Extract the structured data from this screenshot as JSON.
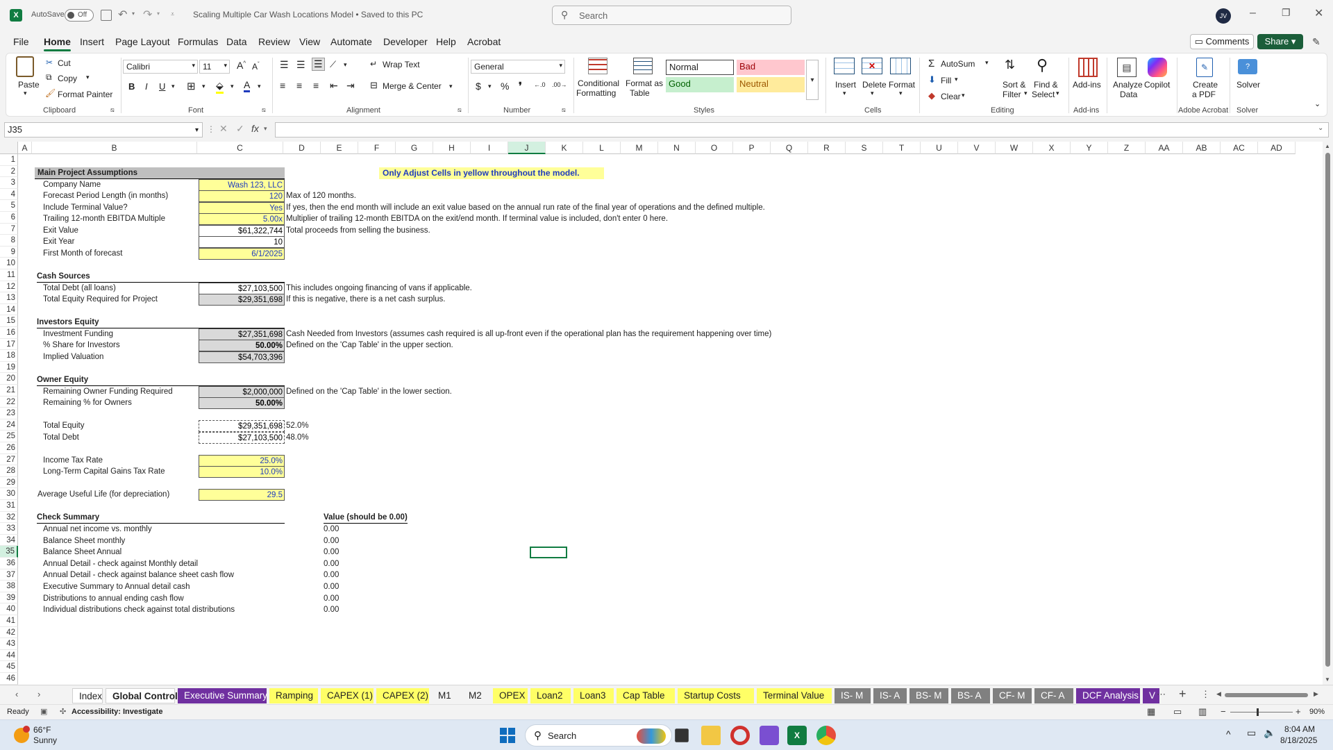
{
  "titlebar": {
    "autosave_label": "AutoSave",
    "autosave_state": "Off",
    "doc_title": "Scaling Multiple Car Wash Locations Model  •  Saved to this PC",
    "search_placeholder": "Search",
    "user_initials": "JV"
  },
  "menu": {
    "items": [
      "File",
      "Home",
      "Insert",
      "Page Layout",
      "Formulas",
      "Data",
      "Review",
      "View",
      "Automate",
      "Developer",
      "Help",
      "Acrobat"
    ],
    "active": "Home",
    "comments": "Comments",
    "share": "Share"
  },
  "ribbon": {
    "clipboard": {
      "paste": "Paste",
      "cut": "Cut",
      "copy": "Copy",
      "format_painter": "Format Painter",
      "group": "Clipboard"
    },
    "font": {
      "name": "Calibri",
      "size": "11",
      "group": "Font"
    },
    "alignment": {
      "wrap": "Wrap Text",
      "merge": "Merge & Center",
      "group": "Alignment"
    },
    "number": {
      "format": "General",
      "group": "Number"
    },
    "styles": {
      "cond_line1": "Conditional",
      "cond_line2": "Formatting",
      "fat_line1": "Format as",
      "fat_line2": "Table",
      "normal": "Normal",
      "bad": "Bad",
      "good": "Good",
      "neutral": "Neutral",
      "group": "Styles"
    },
    "cells": {
      "insert": "Insert",
      "delete": "Delete",
      "format": "Format",
      "group": "Cells"
    },
    "editing": {
      "autosum": "AutoSum",
      "fill": "Fill",
      "clear": "Clear",
      "sort_line1": "Sort &",
      "sort_line2": "Filter",
      "find_line1": "Find &",
      "find_line2": "Select",
      "group": "Editing"
    },
    "addins": {
      "addins": "Add-ins",
      "group": "Add-ins"
    },
    "analyze": {
      "line1": "Analyze",
      "line2": "Data"
    },
    "copilot": "Copilot",
    "acrobat": {
      "line1": "Create",
      "line2": "a PDF",
      "group": "Adobe Acrobat"
    },
    "solver": {
      "label": "Solver",
      "group": "Solver"
    }
  },
  "formula_bar": {
    "name_box": "J35",
    "fx": "fx",
    "formula": ""
  },
  "columns": [
    "A",
    "B",
    "C",
    "D",
    "E",
    "F",
    "G",
    "H",
    "I",
    "J",
    "K",
    "L",
    "M",
    "N",
    "O",
    "P",
    "Q",
    "R",
    "S",
    "T",
    "U",
    "V",
    "W",
    "X",
    "Y",
    "Z",
    "AA",
    "AB",
    "AC",
    "AD"
  ],
  "rows": [
    "1",
    "2",
    "3",
    "4",
    "5",
    "6",
    "7",
    "8",
    "9",
    "10",
    "11",
    "12",
    "13",
    "14",
    "15",
    "16",
    "17",
    "18",
    "19",
    "20",
    "21",
    "22",
    "23",
    "24",
    "25",
    "26",
    "27",
    "28",
    "29",
    "30",
    "31",
    "32",
    "33",
    "34",
    "35",
    "36",
    "37",
    "38",
    "39",
    "40",
    "41",
    "42",
    "43",
    "44",
    "45",
    "46"
  ],
  "sheet": {
    "note": "Only Adjust Cells in yellow throughout the model.",
    "main_header": "Main Project Assumptions",
    "company_label": "Company Name",
    "company_value": "Wash 123, LLC",
    "forecast_label": "Forecast Period Length (in months)",
    "forecast_value": "120",
    "forecast_note": "Max of 120 months.",
    "terminal_label": "Include Terminal Value?",
    "terminal_value": "Yes",
    "terminal_note": "If yes, then the end month will include an exit value based on the annual run rate of the final year of operations and the defined multiple.",
    "multiple_label": "Trailing 12-month EBITDA Multiple",
    "multiple_value": "5.00x",
    "multiple_note": "Multiplier of trailing 12-month EBITDA on the exit/end month. If terminal value is included, don't enter 0 here.",
    "exit_value_label": "Exit Value",
    "exit_value": "$61,322,744",
    "exit_value_note": "Total proceeds from selling the business.",
    "exit_year_label": "Exit Year",
    "exit_year": "10",
    "first_month_label": "First Month of forecast",
    "first_month": "6/1/2025",
    "cash_header": "Cash Sources",
    "debt_label": "Total Debt (all loans)",
    "debt_value": "$27,103,500",
    "debt_note": "This includes ongoing financing of vans if applicable.",
    "equity_req_label": "Total Equity Required for Project",
    "equity_req_value": "$29,351,698",
    "equity_req_note": "If this is negative, there is a net cash surplus.",
    "inv_header": "Investors Equity",
    "inv_fund_label": "Investment Funding",
    "inv_fund_value": "$27,351,698",
    "inv_fund_note": "Cash Needed from Investors (assumes cash required is all up-front even if the operational plan has the requirement happening over time)",
    "inv_share_label": "% Share for Investors",
    "inv_share_value": "50.00%",
    "inv_share_note": "Defined on the 'Cap Table' in the upper section.",
    "implied_label": "Implied Valuation",
    "implied_value": "$54,703,396",
    "owner_header": "Owner Equity",
    "owner_fund_label": "Remaining Owner Funding Required",
    "owner_fund_value": "$2,000,000",
    "owner_fund_note": "Defined on the 'Cap Table' in the lower section.",
    "owner_pct_label": "Remaining % for Owners",
    "owner_pct_value": "50.00%",
    "total_equity_label": "Total Equity",
    "total_equity_value": "$29,351,698",
    "total_equity_pct": "52.0%",
    "total_debt_label": "Total Debt",
    "total_debt_value": "$27,103,500",
    "total_debt_pct": "48.0%",
    "income_tax_label": "Income Tax Rate",
    "income_tax_value": "25.0%",
    "ltcg_label": "Long-Term Capital Gains Tax Rate",
    "ltcg_value": "10.0%",
    "useful_life_label": "Average Useful Life (for depreciation)",
    "useful_life_value": "29.5",
    "check_header": "Check Summary",
    "check_value_header": "Value (should be 0.00)",
    "checks": [
      {
        "label": "Annual net income vs. monthly",
        "value": "0.00"
      },
      {
        "label": "Balance Sheet monthly",
        "value": "0.00"
      },
      {
        "label": "Balance Sheet Annual",
        "value": "0.00"
      },
      {
        "label": "Annual Detail - check against Monthly detail",
        "value": "0.00"
      },
      {
        "label": "Annual Detail - check against balance sheet cash flow",
        "value": "0.00"
      },
      {
        "label": "Executive Summary to Annual detail cash",
        "value": "0.00"
      },
      {
        "label": "Distributions to annual ending cash flow",
        "value": "0.00"
      },
      {
        "label": "Individual distributions check against total distributions",
        "value": "0.00"
      }
    ]
  },
  "tabs": [
    {
      "label": "Index",
      "color": "#ffffff"
    },
    {
      "label": "Global Control",
      "color": "#ffffff"
    },
    {
      "label": "Executive Summary",
      "color": "#7030a0"
    },
    {
      "label": "Ramping",
      "color": "#ffff66"
    },
    {
      "label": "CAPEX (1)",
      "color": "#ffff66"
    },
    {
      "label": "CAPEX (2)",
      "color": "#ffff66"
    },
    {
      "label": "M1",
      "color": "#f3f3f3"
    },
    {
      "label": "M2",
      "color": "#f3f3f3"
    },
    {
      "label": "OPEX",
      "color": "#ffff66"
    },
    {
      "label": "Loan2",
      "color": "#ffff66"
    },
    {
      "label": "Loan3",
      "color": "#ffff66"
    },
    {
      "label": "Cap Table",
      "color": "#ffff66"
    },
    {
      "label": "Startup Costs",
      "color": "#ffff66"
    },
    {
      "label": "Terminal Value",
      "color": "#ffff66"
    },
    {
      "label": "IS- M",
      "color": "#808080"
    },
    {
      "label": "IS- A",
      "color": "#808080"
    },
    {
      "label": "BS- M",
      "color": "#808080"
    },
    {
      "label": "BS- A",
      "color": "#808080"
    },
    {
      "label": "CF- M",
      "color": "#808080"
    },
    {
      "label": "CF- A",
      "color": "#808080"
    },
    {
      "label": "DCF Analysis",
      "color": "#7030a0"
    },
    {
      "label": "V",
      "color": "#7030a0"
    }
  ],
  "status": {
    "ready": "Ready",
    "accessibility": "Accessibility: Investigate",
    "zoom": "90%"
  },
  "taskbar": {
    "temp": "66°F",
    "weather": "Sunny",
    "search": "Search",
    "time": "8:04 AM",
    "date": "8/18/2025"
  }
}
